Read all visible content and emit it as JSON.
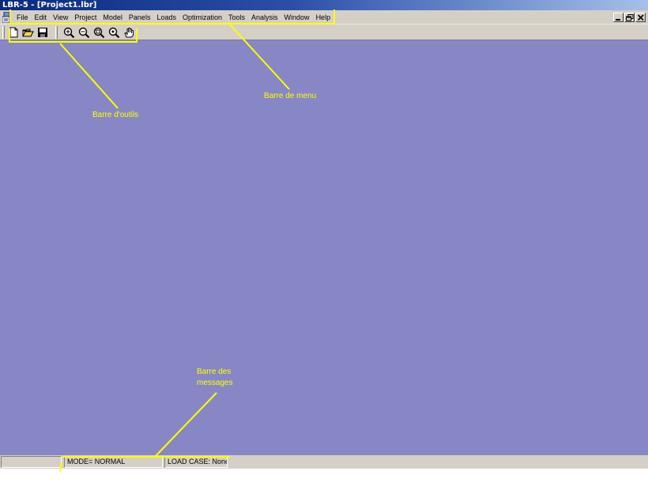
{
  "window": {
    "title": "LBR-5 - [Project1.lbr]"
  },
  "menubar": {
    "items": [
      "File",
      "Edit",
      "View",
      "Project",
      "Model",
      "Panels",
      "Loads",
      "Optimization",
      "Tools",
      "Analysis",
      "Window",
      "Help"
    ]
  },
  "toolbar": {
    "buttons": [
      "new-document-icon",
      "open-folder-icon",
      "save-disk-icon",
      "zoom-in-icon",
      "zoom-out-icon",
      "zoom-window-icon",
      "zoom-all-icon",
      "pan-hand-icon"
    ]
  },
  "statusbar": {
    "panel1": "",
    "mode": "MODE= NORMAL",
    "load_case": "LOAD CASE: None"
  },
  "annotations": {
    "menu_label": "Barre de menu",
    "toolbar_label": "Barre d'outils",
    "messages_label_line1": "Barre des",
    "messages_label_line2": "messages"
  },
  "colors": {
    "workspace": "#8787c6",
    "annotation": "#ffff00",
    "titlebar_start": "#0a2a7c",
    "chrome": "#d4d0c8"
  }
}
